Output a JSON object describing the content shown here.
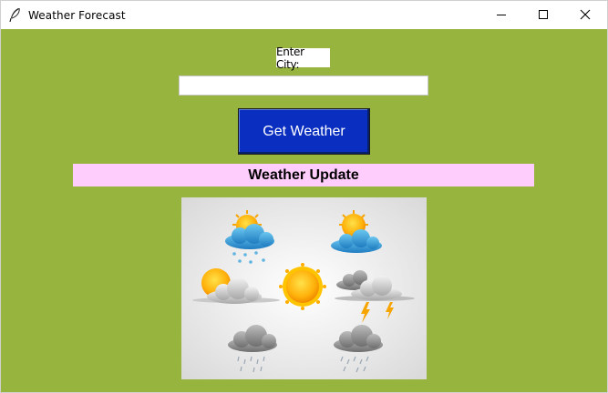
{
  "window": {
    "title": "Weather Forecast"
  },
  "form": {
    "city_label": "Enter City:",
    "city_value": "",
    "get_weather_label": "Get Weather"
  },
  "result": {
    "header": "Weather Update"
  },
  "icons": {
    "app": "feather-icon",
    "minimize": "minimize-icon",
    "maximize": "maximize-icon",
    "close": "close-icon",
    "image": "weather-icons-image"
  },
  "colors": {
    "background": "#97b43e",
    "button": "#0a2fc0",
    "header_bar": "#ffcdfc"
  }
}
